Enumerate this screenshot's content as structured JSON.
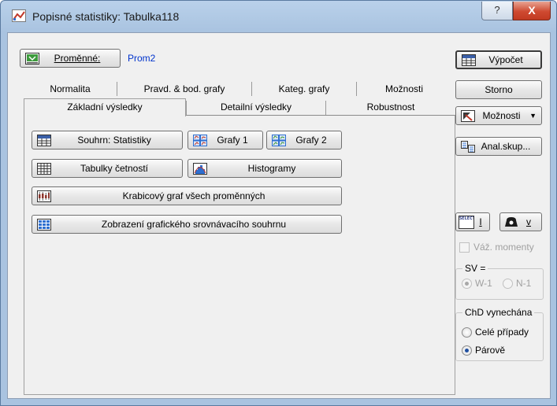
{
  "window": {
    "title": "Popisné statistiky: Tabulka118",
    "help_label": "?",
    "close_label": "X"
  },
  "variables": {
    "button_label": "Proměnné:",
    "value": "Prom2"
  },
  "tabs_row1": [
    "Normalita",
    "Pravd. & bod. grafy",
    "Kateg. grafy",
    "Možnosti"
  ],
  "tabs_row2": [
    "Základní výsledky",
    "Detailní výsledky",
    "Robustnost"
  ],
  "panel_buttons": {
    "summary_stats": "Souhrn: Statistiky",
    "graphs1": "Grafy 1",
    "graphs2": "Grafy 2",
    "freq_tables": "Tabulky četností",
    "histograms": "Histogramy",
    "boxplot_all": "Krabicový graf všech proměnných",
    "comparison_summary": "Zobrazení grafického srovnávacího souhrnu"
  },
  "side": {
    "compute": "Výpočet",
    "cancel": "Storno",
    "options": "Možnosti",
    "group_analysis": "Anal.skup...",
    "select_cases_icon_text": "SELECT CASES",
    "s_label": "I",
    "w_label": "v",
    "weighted_moments": "Váž. momenty",
    "df_title": "SV =",
    "df_options": [
      "W-1",
      "N-1"
    ],
    "md_title": "ChD vynechána",
    "md_options": [
      "Celé případy",
      "Párově"
    ]
  },
  "colors": {
    "variable_value": "#0033cc",
    "title_bar": "#a9c3e0",
    "close_button": "#c94630"
  }
}
